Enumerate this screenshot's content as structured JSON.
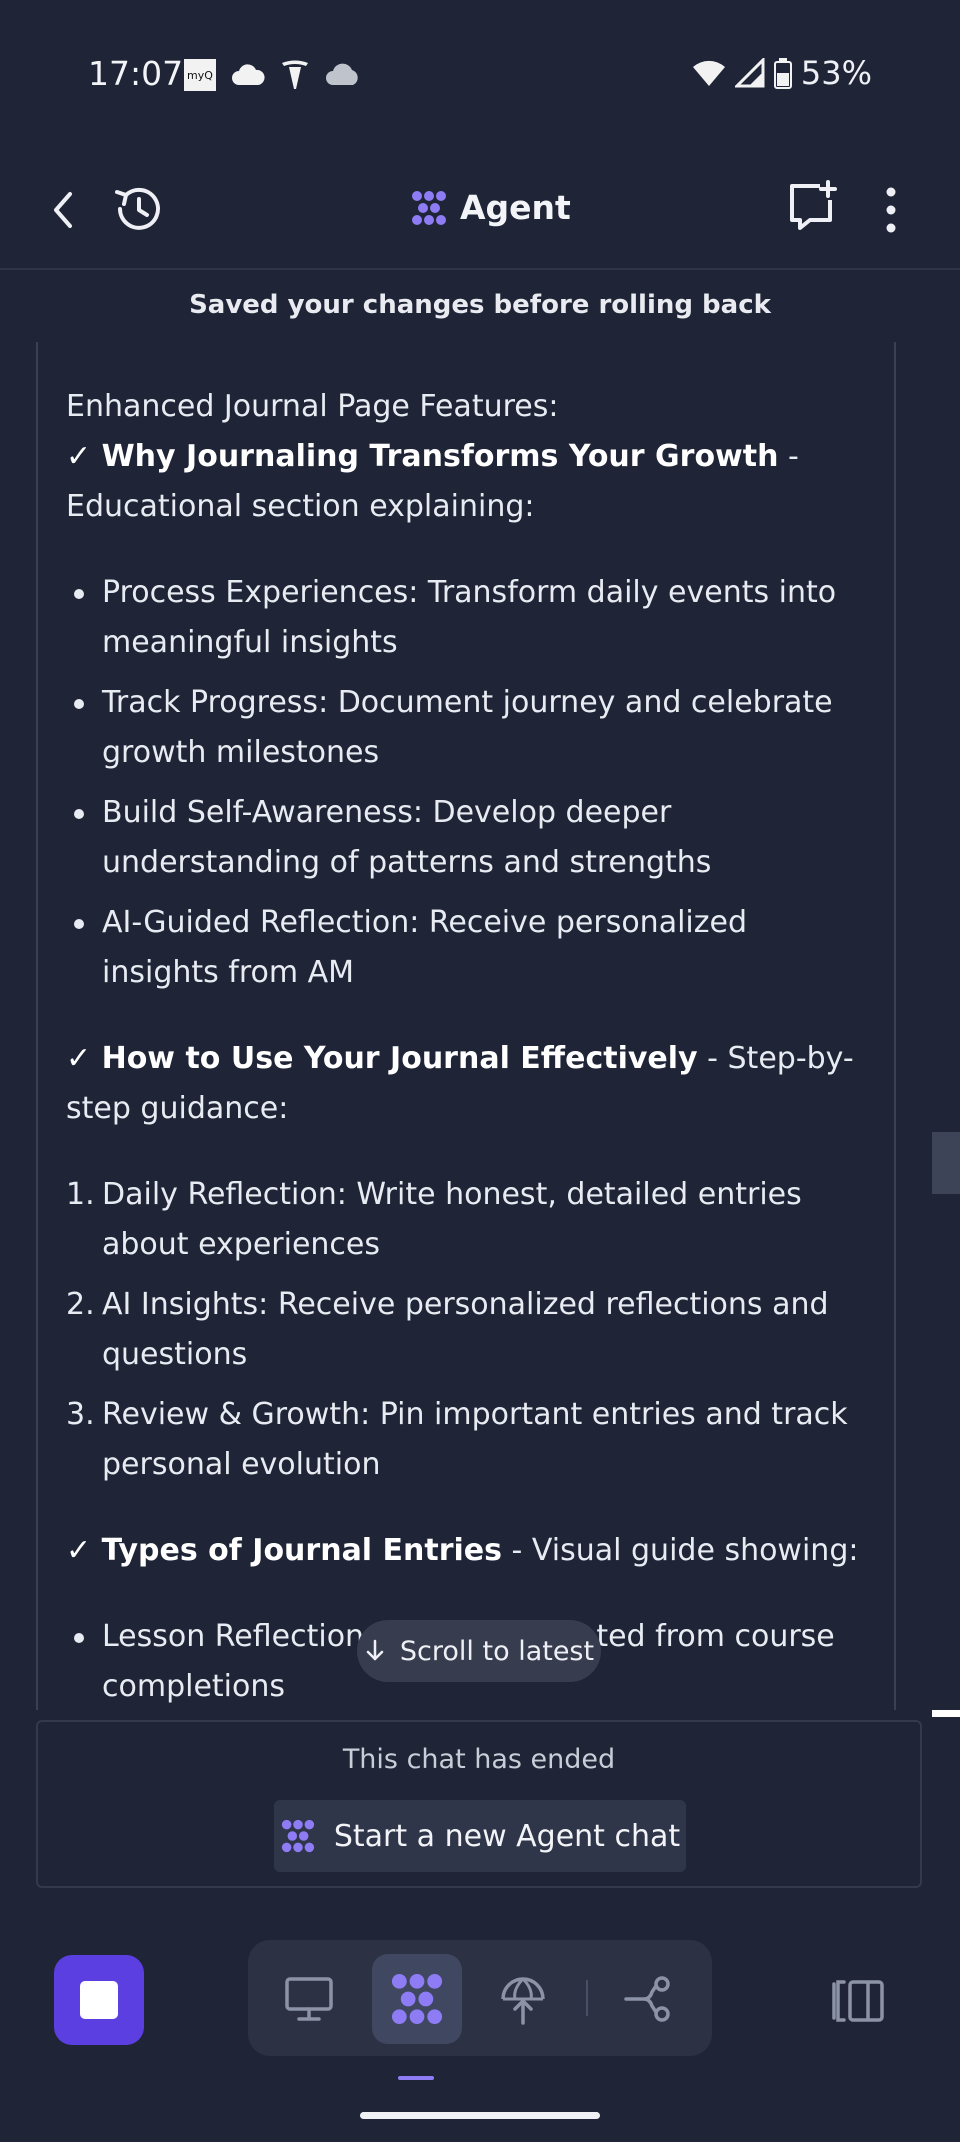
{
  "status_bar": {
    "time": "17:07",
    "battery": "53%",
    "app_icons": [
      "myq-icon",
      "cloud-icon",
      "tesla-icon",
      "weather-cloud-icon"
    ]
  },
  "header": {
    "title": "Agent"
  },
  "toast": "Saved your changes before rolling back",
  "message": {
    "intro": "Enhanced Journal Page Features:",
    "section1": {
      "check": "✓",
      "title": "Why Journaling Transforms Your Growth",
      "rest": " - Educational section explaining:",
      "items": [
        "Process Experiences: Transform daily events into meaningful insights",
        "Track Progress: Document journey and celebrate growth milestones",
        "Build Self-Awareness: Develop deeper understanding of patterns and strengths",
        "AI-Guided Reflection: Receive personalized insights from AM"
      ]
    },
    "section2": {
      "check": "✓",
      "title": "How to Use Your Journal Effectively",
      "rest": " - Step-by-step guidance:",
      "items": [
        {
          "num": "1.",
          "text": "Daily Reflection: Write honest, detailed entries about experiences"
        },
        {
          "num": "2.",
          "text": "AI Insights: Receive personalized reflections and questions"
        },
        {
          "num": "3.",
          "text": "Review & Growth: Pin important entries and track personal evolution"
        }
      ]
    },
    "section3": {
      "check": "✓",
      "title": "Types of Journal Entries",
      "rest": " - Visual guide showing:",
      "items": [
        "Lesson Reflections - Auto-generated from course completions"
      ]
    }
  },
  "scroll_button": "Scroll to latest",
  "ended_panel": {
    "text": "This chat has ended",
    "button": "Start a new Agent chat"
  },
  "colors": {
    "background": "#1f2536",
    "accent": "#8e7cf5",
    "stop_button": "#5b3fe0"
  }
}
